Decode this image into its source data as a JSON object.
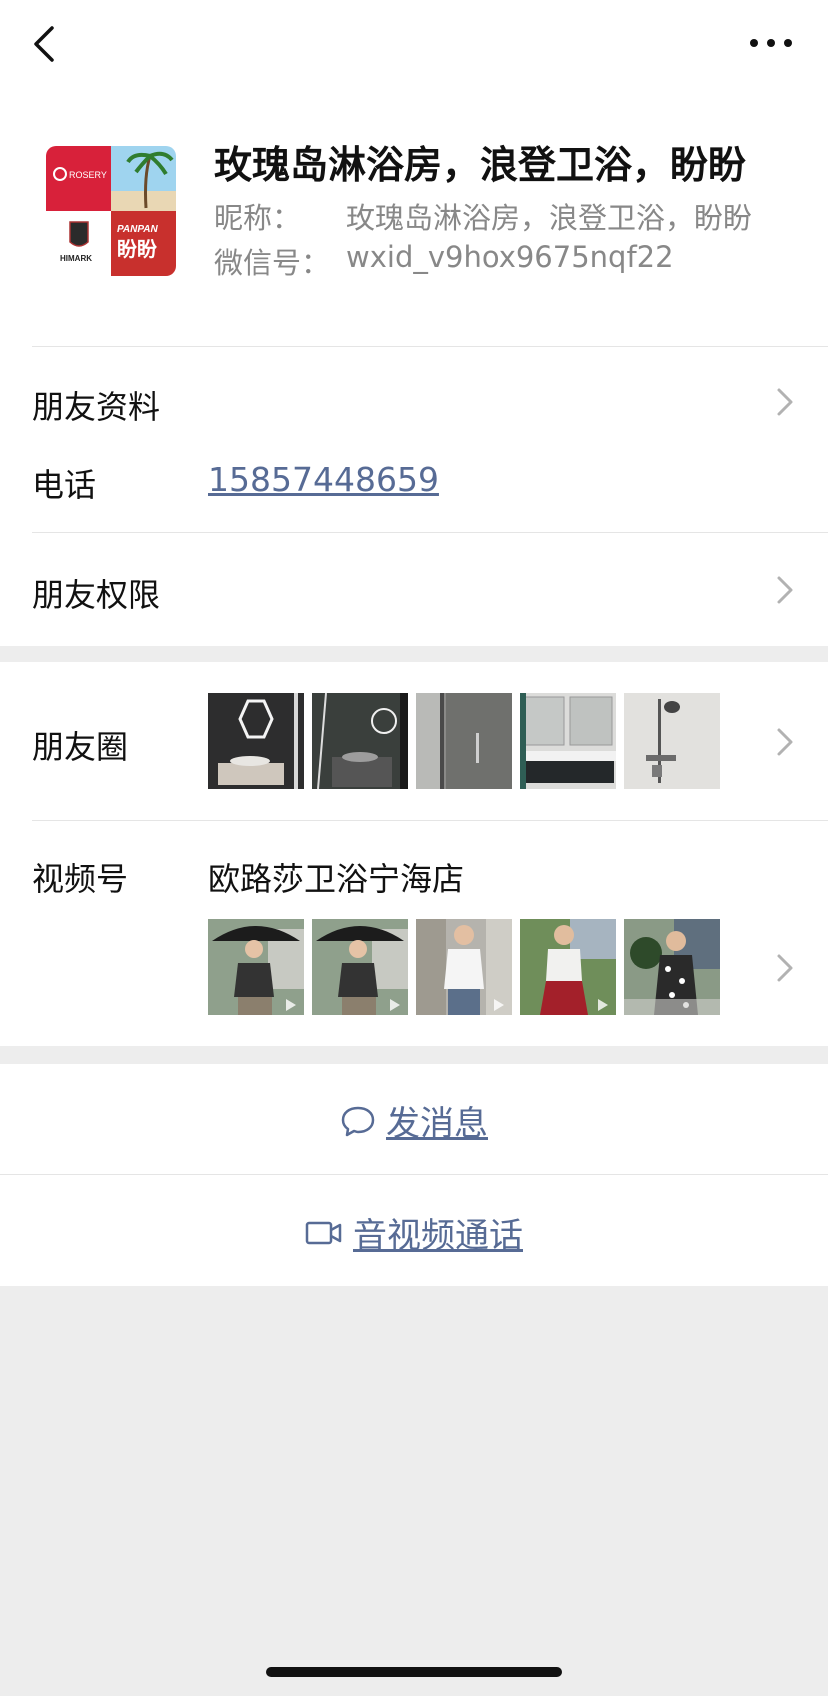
{
  "header": {
    "back_icon": "chevron-left-icon",
    "more_icon": "more-horizontal-icon"
  },
  "profile": {
    "avatar_icon": "brand-logo-collage",
    "avatar_text": {
      "rosery": "ROSERY",
      "himark": "HIMARK",
      "panpan": "PANPAN",
      "panpan_cn": "盼盼"
    },
    "display_name": "玫瑰岛淋浴房，浪登卫浴，盼盼",
    "nickname_label": "昵称：",
    "nickname_value": "玫瑰岛淋浴房，浪登卫浴，盼盼",
    "wechat_id_label": "微信号：",
    "wechat_id_value": "wxid_v9hox9675nqf22"
  },
  "info": {
    "friend_profile_label": "朋友资料",
    "phone_label": "电话",
    "phone_value": "15857448659",
    "permissions_label": "朋友权限"
  },
  "moments": {
    "label": "朋友圈",
    "thumbnails": [
      {
        "name": "bathroom-hexagon-mirror"
      },
      {
        "name": "bathroom-round-mirror"
      },
      {
        "name": "shower-glass-door"
      },
      {
        "name": "vanity-cabinet"
      },
      {
        "name": "shower-fixture"
      }
    ]
  },
  "channels": {
    "label": "视频号",
    "channel_name": "欧路莎卫浴宁海店",
    "thumbnails": [
      {
        "name": "video-woman-umbrella-1"
      },
      {
        "name": "video-woman-umbrella-2"
      },
      {
        "name": "video-woman-white-shirt"
      },
      {
        "name": "video-woman-red-skirt"
      },
      {
        "name": "video-woman-floral-dress"
      }
    ]
  },
  "actions": {
    "message_icon": "chat-bubble-icon",
    "message_label": "发消息",
    "call_icon": "video-camera-icon",
    "call_label": "音视频通话"
  },
  "colors": {
    "link_blue": "#576b95",
    "background": "#ededed"
  }
}
